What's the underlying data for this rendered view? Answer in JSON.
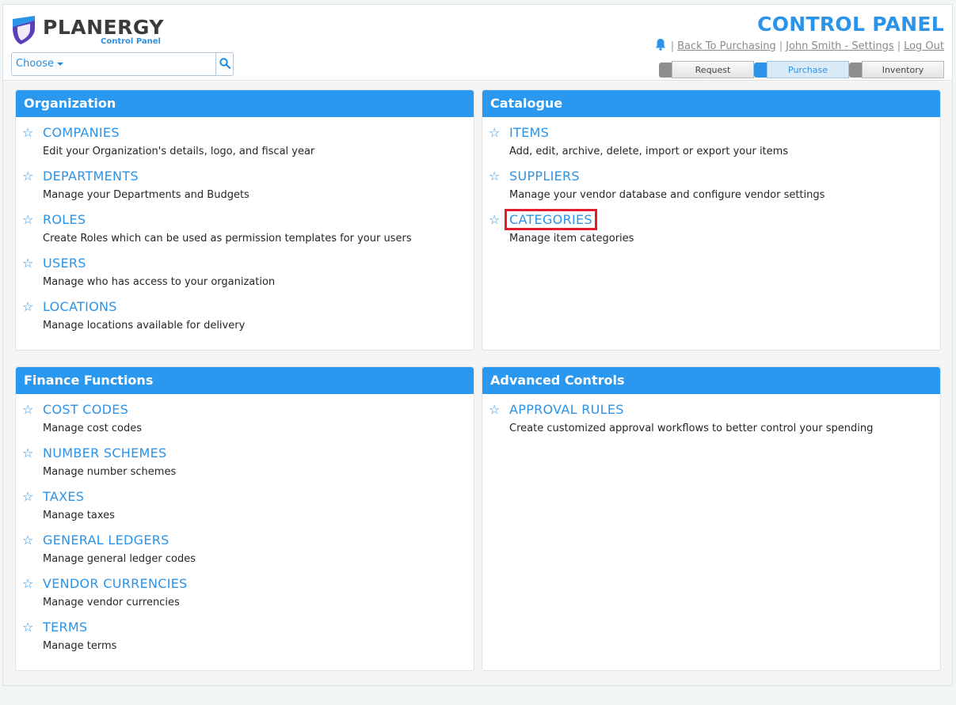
{
  "brand": {
    "name": "PLANERGY",
    "subtitle": "Control Panel"
  },
  "search": {
    "choose_label": "Choose"
  },
  "header": {
    "title": "CONTROL PANEL",
    "links": [
      "Back To Purchasing",
      "John Smith - Settings",
      "Log Out"
    ],
    "separator": "|"
  },
  "tabs": [
    {
      "label": "Request",
      "active": false
    },
    {
      "label": "Purchase",
      "active": true
    },
    {
      "label": "Inventory",
      "active": false
    }
  ],
  "panels": {
    "organization": {
      "title": "Organization",
      "items": [
        {
          "title": "COMPANIES",
          "desc": "Edit your Organization's details, logo, and fiscal year"
        },
        {
          "title": "DEPARTMENTS",
          "desc": "Manage your Departments and Budgets"
        },
        {
          "title": "ROLES",
          "desc": "Create Roles which can be used as permission templates for your users"
        },
        {
          "title": "USERS",
          "desc": "Manage who has access to your organization"
        },
        {
          "title": "LOCATIONS",
          "desc": "Manage locations available for delivery"
        }
      ]
    },
    "catalogue": {
      "title": "Catalogue",
      "items": [
        {
          "title": "ITEMS",
          "desc": "Add, edit, archive, delete, import or export your items"
        },
        {
          "title": "SUPPLIERS",
          "desc": "Manage your vendor database and configure vendor settings"
        },
        {
          "title": "CATEGORIES",
          "desc": "Manage item categories"
        }
      ]
    },
    "finance": {
      "title": "Finance Functions",
      "items": [
        {
          "title": "COST CODES",
          "desc": "Manage cost codes"
        },
        {
          "title": "NUMBER SCHEMES",
          "desc": "Manage number schemes"
        },
        {
          "title": "TAXES",
          "desc": "Manage taxes"
        },
        {
          "title": "GENERAL LEDGERS",
          "desc": "Manage general ledger codes"
        },
        {
          "title": "VENDOR CURRENCIES",
          "desc": "Manage vendor currencies"
        },
        {
          "title": "TERMS",
          "desc": "Manage terms"
        }
      ]
    },
    "advanced": {
      "title": "Advanced Controls",
      "items": [
        {
          "title": "APPROVAL RULES",
          "desc": "Create customized approval workflows to better control your spending"
        }
      ]
    }
  },
  "icons": {
    "star": "☆",
    "bell": "bell-icon",
    "search": "search-icon",
    "logo": "shield-logo-icon"
  },
  "colors": {
    "accent": "#2b98f0",
    "highlight": "#e11d2e",
    "text": "#262626"
  }
}
